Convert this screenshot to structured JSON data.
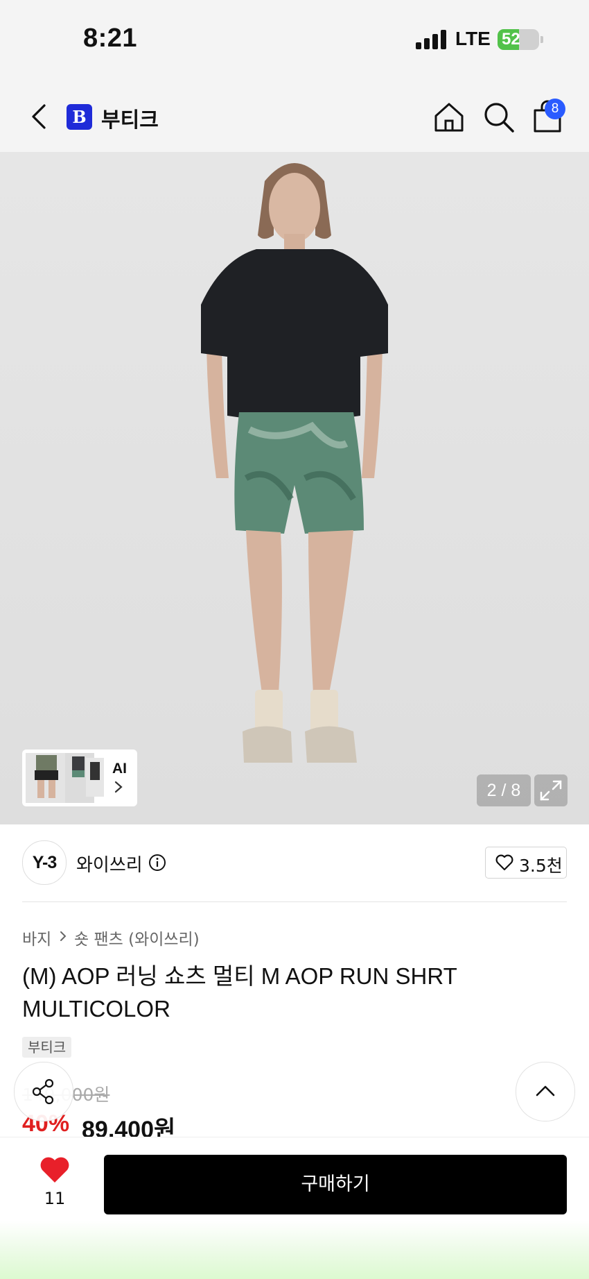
{
  "status_bar": {
    "time": "8:21",
    "network": "LTE",
    "battery": "52",
    "battery_level": 0.52
  },
  "nav": {
    "store_logo_letter": "B",
    "store_name": "부티크",
    "cart_count": "8"
  },
  "gallery": {
    "ai_label": "AI",
    "counter": "2 / 8"
  },
  "brand": {
    "logo_text": "Y-3",
    "name": "와이쓰리",
    "like_count": "3.5천"
  },
  "breadcrumb": {
    "level1": "바지",
    "level2": "숏 팬츠 (와이쓰리)"
  },
  "product": {
    "title": "(M) AOP 러닝 쇼츠 멀티 M AOP RUN SHRT MULTICOLOR",
    "tag": "부티크",
    "original_price": "149,000원",
    "discount": "40%",
    "sale_price": "89,400원"
  },
  "bottom": {
    "wish_count": "11",
    "buy_label": "구매하기"
  },
  "colors": {
    "accent_blue": "#2a5bff",
    "logo_blue": "#1f2bd8",
    "discount_red": "#e02020",
    "heart_red": "#e8202a"
  }
}
